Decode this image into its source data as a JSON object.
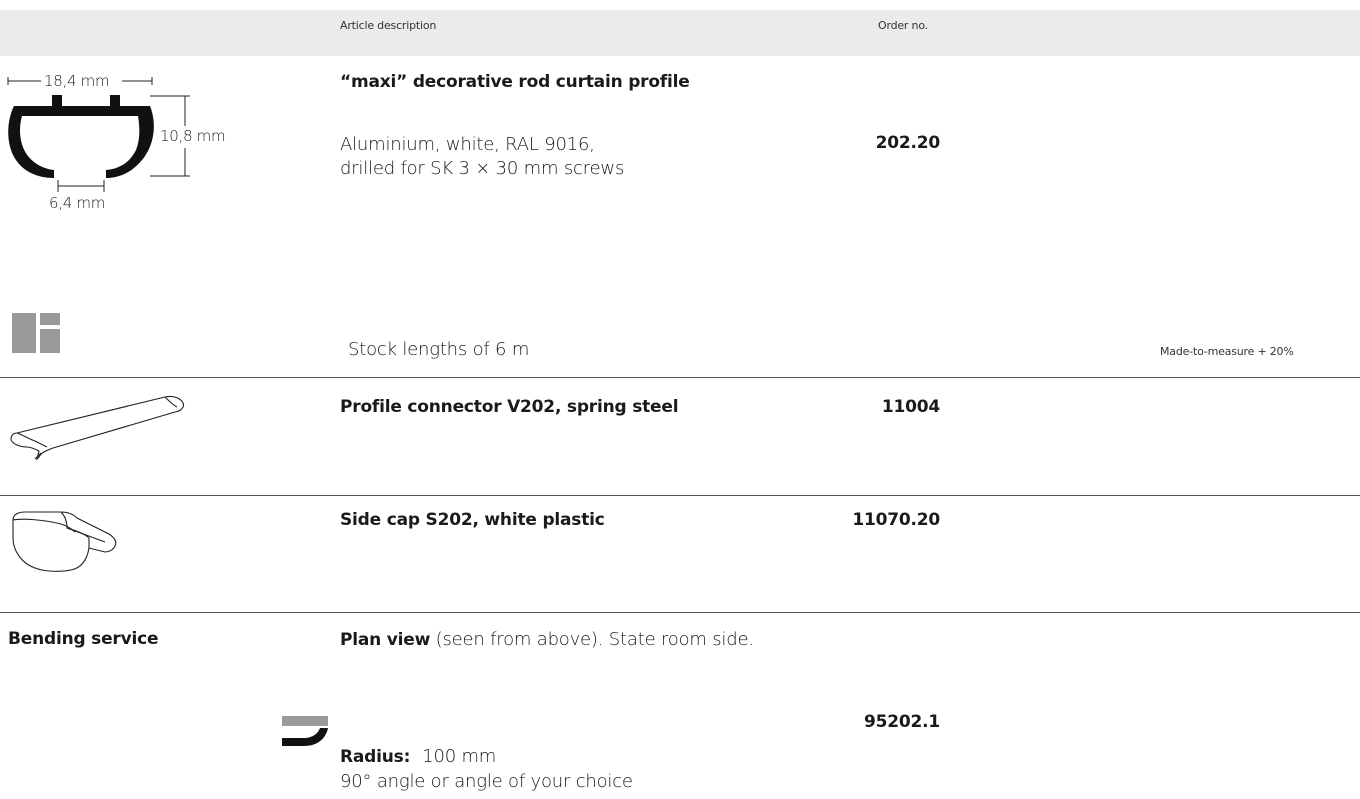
{
  "header": {
    "article_description": "Article description",
    "order_no": "Order no."
  },
  "profile": {
    "title": "“maxi” decorative rod curtain profile",
    "description_line1": "Aluminium, white, RAL 9016,",
    "description_line2": "drilled for SK 3 × 30 mm screws",
    "order_no": "202.20",
    "dim_width": "18,4 mm",
    "dim_height": "10,8 mm",
    "dim_opening": "6,4 mm"
  },
  "info": {
    "stock": "Stock lengths of 6 m",
    "made_to_measure": "Made-to-measure + 20%"
  },
  "connector": {
    "title": "Profile connector V202, spring steel",
    "order_no": "11004"
  },
  "side_cap": {
    "title": "Side cap S202, white plastic",
    "order_no": "11070.20"
  },
  "bending": {
    "label": "Bending service",
    "plan_view_bold": "Plan view",
    "plan_view_rest": " (seen from above). State room side.",
    "radius_label": "Radius:",
    "radius_value": "100 mm",
    "angle_text": "90° angle or angle of your choice",
    "order_no": "95202.1"
  }
}
